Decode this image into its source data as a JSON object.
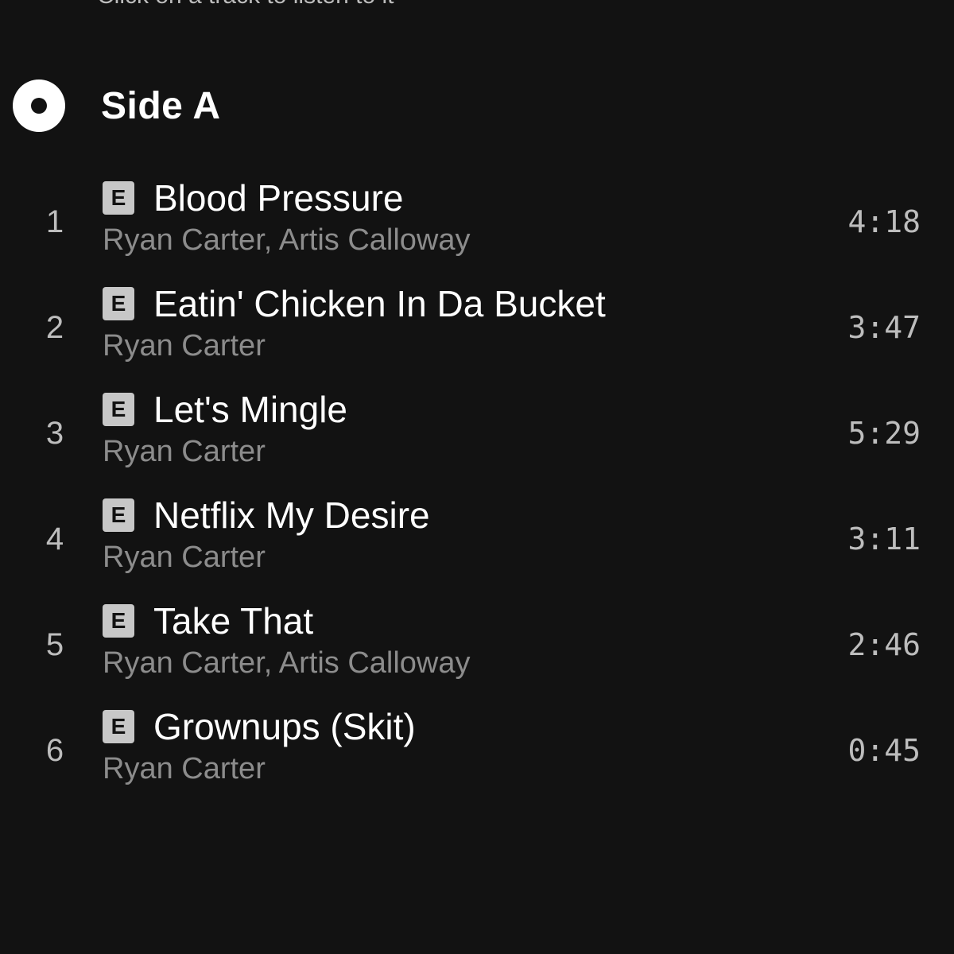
{
  "header": {
    "cut_text": "Click on a track to listen to it",
    "side_title": "Side A"
  },
  "tracks": [
    {
      "number": "1",
      "explicit": "E",
      "title": "Blood Pressure",
      "artists": "Ryan Carter, Artis Calloway",
      "duration": "4:18"
    },
    {
      "number": "2",
      "explicit": "E",
      "title": "Eatin' Chicken In Da Bucket",
      "artists": "Ryan Carter",
      "duration": "3:47"
    },
    {
      "number": "3",
      "explicit": "E",
      "title": "Let's Mingle",
      "artists": "Ryan Carter",
      "duration": "5:29"
    },
    {
      "number": "4",
      "explicit": "E",
      "title": "Netflix My Desire",
      "artists": "Ryan Carter",
      "duration": "3:11"
    },
    {
      "number": "5",
      "explicit": "E",
      "title": "Take That",
      "artists": "Ryan Carter, Artis Calloway",
      "duration": "2:46"
    },
    {
      "number": "6",
      "explicit": "E",
      "title": "Grownups (Skit)",
      "artists": "Ryan Carter",
      "duration": "0:45"
    }
  ],
  "icons": {
    "disc": "disc-icon",
    "explicit": "explicit-badge"
  },
  "colors": {
    "background": "#121212",
    "primary_text": "#ffffff",
    "secondary_text": "#8c8c8c",
    "badge": "#c7c7c7"
  }
}
